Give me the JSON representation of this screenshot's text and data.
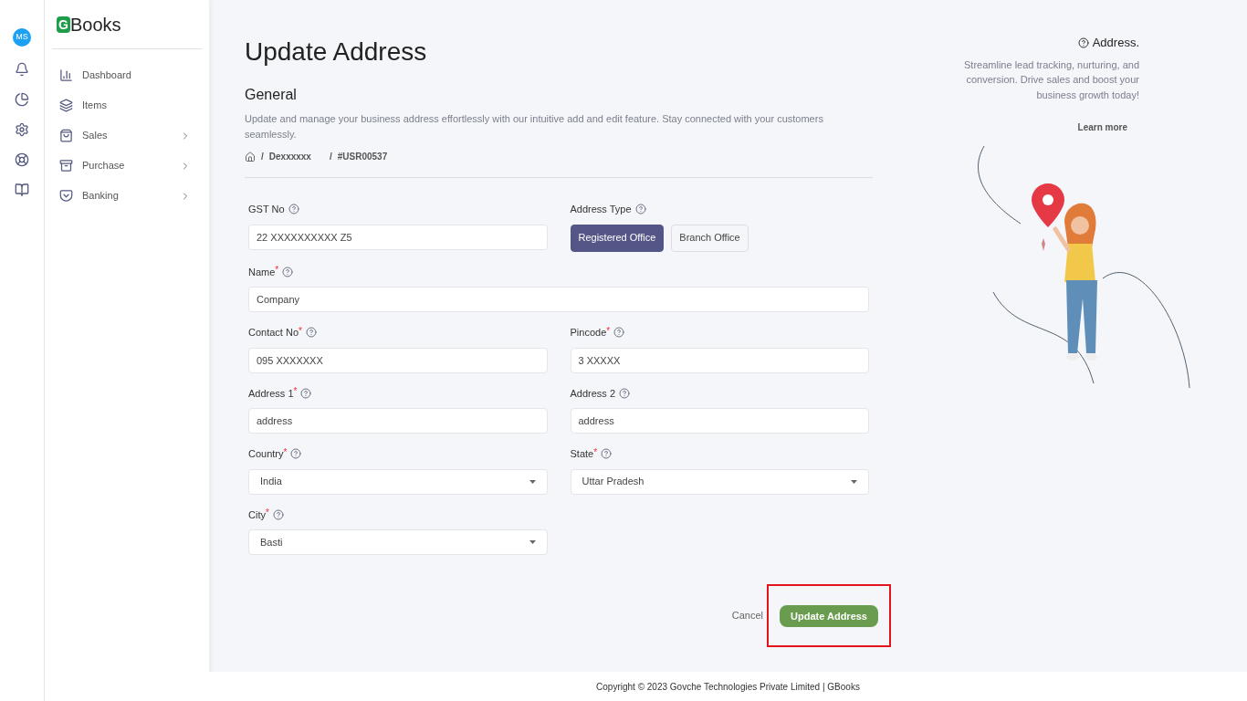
{
  "rail": {
    "avatar": "MS"
  },
  "brand": {
    "letter": "G",
    "name": "Books"
  },
  "nav": [
    {
      "label": "Dashboard",
      "has_submenu": false
    },
    {
      "label": "Items",
      "has_submenu": false
    },
    {
      "label": "Sales",
      "has_submenu": true
    },
    {
      "label": "Purchase",
      "has_submenu": true
    },
    {
      "label": "Banking",
      "has_submenu": true
    }
  ],
  "page": {
    "title": "Update Address",
    "section": "General",
    "description": "Update and manage your business address effortlessly with our intuitive add and edit feature. Stay connected with your customers seamlessly.",
    "breadcrumb": [
      {
        "separator": "/",
        "label": "Dexxxxxx"
      },
      {
        "separator": "/",
        "label": "#USR00537"
      }
    ]
  },
  "form_rows": [
    [
      {
        "kind": "text",
        "label": "GST No",
        "value": "22 XXXXXXXXXX Z5",
        "full": false
      },
      {
        "kind": "choice",
        "label": "Address Type",
        "options": [
          {
            "label": "Registered Office",
            "selected": true
          },
          {
            "label": "Branch Office",
            "selected": false
          }
        ]
      }
    ],
    [
      {
        "kind": "text",
        "label": "Name",
        "required_mark": "*",
        "value": "Company",
        "full": true
      }
    ],
    [
      {
        "kind": "text",
        "label": "Contact No",
        "required_mark": "*",
        "value": "095 XXXXXXX",
        "full": false
      },
      {
        "kind": "text",
        "label": "Pincode",
        "required_mark": "*",
        "value": "3 XXXXX",
        "full": false
      }
    ],
    [
      {
        "kind": "text",
        "label": "Address 1",
        "required_mark": "*",
        "value": "address",
        "full": false
      },
      {
        "kind": "text",
        "label": "Address 2",
        "value": "address",
        "full": false
      }
    ],
    [
      {
        "kind": "select",
        "label": "Country",
        "required_mark": "*",
        "value": "India",
        "full": false
      },
      {
        "kind": "select",
        "label": "State",
        "required_mark": "*",
        "value": "Uttar Pradesh",
        "full": false
      }
    ],
    [
      {
        "kind": "select",
        "label": "City",
        "required_mark": "*",
        "value": "Basti",
        "full": false
      }
    ]
  ],
  "actions": {
    "cancel": "Cancel",
    "submit": "Update Address",
    "submit_highlighted": true
  },
  "info": {
    "title": "Address.",
    "text": "Streamline lead tracking, nurturing, and conversion. Drive sales and boost your business growth today!",
    "link": "Learn more"
  },
  "footer": "Copyright © 2023 Govche Technologies Private Limited | GBooks"
}
